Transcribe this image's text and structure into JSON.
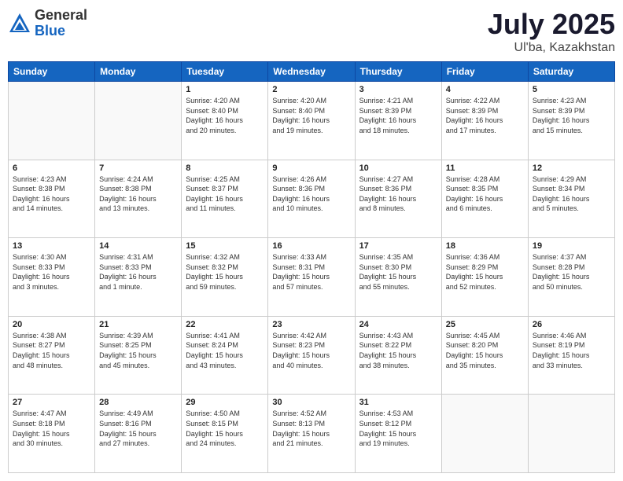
{
  "logo": {
    "general": "General",
    "blue": "Blue"
  },
  "header": {
    "month": "July 2025",
    "location": "Ul'ba, Kazakhstan"
  },
  "weekdays": [
    "Sunday",
    "Monday",
    "Tuesday",
    "Wednesday",
    "Thursday",
    "Friday",
    "Saturday"
  ],
  "weeks": [
    [
      {
        "day": "",
        "detail": ""
      },
      {
        "day": "",
        "detail": ""
      },
      {
        "day": "1",
        "detail": "Sunrise: 4:20 AM\nSunset: 8:40 PM\nDaylight: 16 hours\nand 20 minutes."
      },
      {
        "day": "2",
        "detail": "Sunrise: 4:20 AM\nSunset: 8:40 PM\nDaylight: 16 hours\nand 19 minutes."
      },
      {
        "day": "3",
        "detail": "Sunrise: 4:21 AM\nSunset: 8:39 PM\nDaylight: 16 hours\nand 18 minutes."
      },
      {
        "day": "4",
        "detail": "Sunrise: 4:22 AM\nSunset: 8:39 PM\nDaylight: 16 hours\nand 17 minutes."
      },
      {
        "day": "5",
        "detail": "Sunrise: 4:23 AM\nSunset: 8:39 PM\nDaylight: 16 hours\nand 15 minutes."
      }
    ],
    [
      {
        "day": "6",
        "detail": "Sunrise: 4:23 AM\nSunset: 8:38 PM\nDaylight: 16 hours\nand 14 minutes."
      },
      {
        "day": "7",
        "detail": "Sunrise: 4:24 AM\nSunset: 8:38 PM\nDaylight: 16 hours\nand 13 minutes."
      },
      {
        "day": "8",
        "detail": "Sunrise: 4:25 AM\nSunset: 8:37 PM\nDaylight: 16 hours\nand 11 minutes."
      },
      {
        "day": "9",
        "detail": "Sunrise: 4:26 AM\nSunset: 8:36 PM\nDaylight: 16 hours\nand 10 minutes."
      },
      {
        "day": "10",
        "detail": "Sunrise: 4:27 AM\nSunset: 8:36 PM\nDaylight: 16 hours\nand 8 minutes."
      },
      {
        "day": "11",
        "detail": "Sunrise: 4:28 AM\nSunset: 8:35 PM\nDaylight: 16 hours\nand 6 minutes."
      },
      {
        "day": "12",
        "detail": "Sunrise: 4:29 AM\nSunset: 8:34 PM\nDaylight: 16 hours\nand 5 minutes."
      }
    ],
    [
      {
        "day": "13",
        "detail": "Sunrise: 4:30 AM\nSunset: 8:33 PM\nDaylight: 16 hours\nand 3 minutes."
      },
      {
        "day": "14",
        "detail": "Sunrise: 4:31 AM\nSunset: 8:33 PM\nDaylight: 16 hours\nand 1 minute."
      },
      {
        "day": "15",
        "detail": "Sunrise: 4:32 AM\nSunset: 8:32 PM\nDaylight: 15 hours\nand 59 minutes."
      },
      {
        "day": "16",
        "detail": "Sunrise: 4:33 AM\nSunset: 8:31 PM\nDaylight: 15 hours\nand 57 minutes."
      },
      {
        "day": "17",
        "detail": "Sunrise: 4:35 AM\nSunset: 8:30 PM\nDaylight: 15 hours\nand 55 minutes."
      },
      {
        "day": "18",
        "detail": "Sunrise: 4:36 AM\nSunset: 8:29 PM\nDaylight: 15 hours\nand 52 minutes."
      },
      {
        "day": "19",
        "detail": "Sunrise: 4:37 AM\nSunset: 8:28 PM\nDaylight: 15 hours\nand 50 minutes."
      }
    ],
    [
      {
        "day": "20",
        "detail": "Sunrise: 4:38 AM\nSunset: 8:27 PM\nDaylight: 15 hours\nand 48 minutes."
      },
      {
        "day": "21",
        "detail": "Sunrise: 4:39 AM\nSunset: 8:25 PM\nDaylight: 15 hours\nand 45 minutes."
      },
      {
        "day": "22",
        "detail": "Sunrise: 4:41 AM\nSunset: 8:24 PM\nDaylight: 15 hours\nand 43 minutes."
      },
      {
        "day": "23",
        "detail": "Sunrise: 4:42 AM\nSunset: 8:23 PM\nDaylight: 15 hours\nand 40 minutes."
      },
      {
        "day": "24",
        "detail": "Sunrise: 4:43 AM\nSunset: 8:22 PM\nDaylight: 15 hours\nand 38 minutes."
      },
      {
        "day": "25",
        "detail": "Sunrise: 4:45 AM\nSunset: 8:20 PM\nDaylight: 15 hours\nand 35 minutes."
      },
      {
        "day": "26",
        "detail": "Sunrise: 4:46 AM\nSunset: 8:19 PM\nDaylight: 15 hours\nand 33 minutes."
      }
    ],
    [
      {
        "day": "27",
        "detail": "Sunrise: 4:47 AM\nSunset: 8:18 PM\nDaylight: 15 hours\nand 30 minutes."
      },
      {
        "day": "28",
        "detail": "Sunrise: 4:49 AM\nSunset: 8:16 PM\nDaylight: 15 hours\nand 27 minutes."
      },
      {
        "day": "29",
        "detail": "Sunrise: 4:50 AM\nSunset: 8:15 PM\nDaylight: 15 hours\nand 24 minutes."
      },
      {
        "day": "30",
        "detail": "Sunrise: 4:52 AM\nSunset: 8:13 PM\nDaylight: 15 hours\nand 21 minutes."
      },
      {
        "day": "31",
        "detail": "Sunrise: 4:53 AM\nSunset: 8:12 PM\nDaylight: 15 hours\nand 19 minutes."
      },
      {
        "day": "",
        "detail": ""
      },
      {
        "day": "",
        "detail": ""
      }
    ]
  ]
}
